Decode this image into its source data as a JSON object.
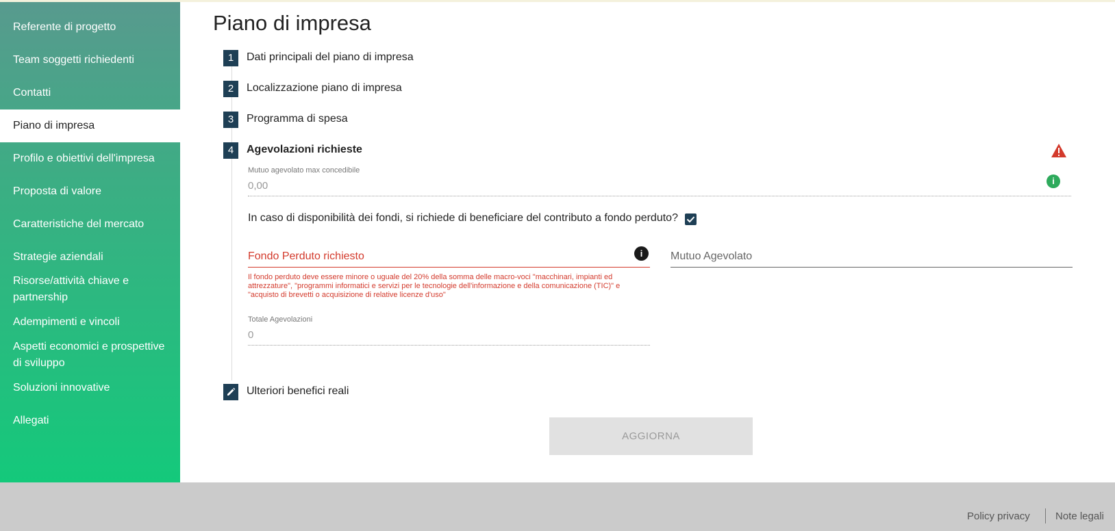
{
  "sidebar": {
    "items": [
      {
        "label": "Referente di progetto"
      },
      {
        "label": "Team soggetti richiedenti"
      },
      {
        "label": "Contatti"
      },
      {
        "label": "Piano di impresa"
      },
      {
        "label": "Profilo e obiettivi dell'impresa"
      },
      {
        "label": "Proposta di valore"
      },
      {
        "label": "Caratteristiche del mercato"
      },
      {
        "label": "Strategie aziendali"
      },
      {
        "label": "Risorse/attività chiave e partnership"
      },
      {
        "label": "Adempimenti e vincoli"
      },
      {
        "label": "Aspetti economici e prospettive di sviluppo"
      },
      {
        "label": "Soluzioni innovative"
      },
      {
        "label": "Allegati"
      }
    ],
    "active_index": 3
  },
  "main": {
    "title": "Piano di impresa",
    "steps": [
      {
        "num": "1",
        "label": "Dati principali del piano di impresa"
      },
      {
        "num": "2",
        "label": "Localizzazione piano di impresa"
      },
      {
        "num": "3",
        "label": "Programma di spesa"
      },
      {
        "num": "4",
        "label": "Agevolazioni richieste"
      }
    ],
    "mutuo_max": {
      "label": "Mutuo agevolato max concedibile",
      "value": "0,00"
    },
    "question": "In caso di disponibilità dei fondi, si richiede di beneficiare del contributo a fondo perduto?",
    "question_checked": true,
    "fondo_perduto": {
      "label": "Fondo Perduto richiesto",
      "error": "Il fondo perduto deve essere minore o uguale del 20% della somma delle macro-voci \"macchinari, impianti ed attrezzature\", \"programmi informatici e servizi per le tecnologie dell'informazione e della comunicazione (TIC)\" e \"acquisto di brevetti o acquisizione di relative licenze d'uso\""
    },
    "mutuo_agevolato": {
      "label": "Mutuo Agevolato"
    },
    "totale": {
      "label": "Totale Agevolazioni",
      "value": "0"
    },
    "extra_step": {
      "label": "Ulteriori benefici reali"
    },
    "update_button": "AGGIORNA"
  },
  "footer": {
    "privacy": "Policy privacy",
    "legal": "Note legali"
  },
  "colors": {
    "step_badge": "#1e3f55",
    "error": "#d33a2c",
    "info_green": "#2eaa5c"
  }
}
